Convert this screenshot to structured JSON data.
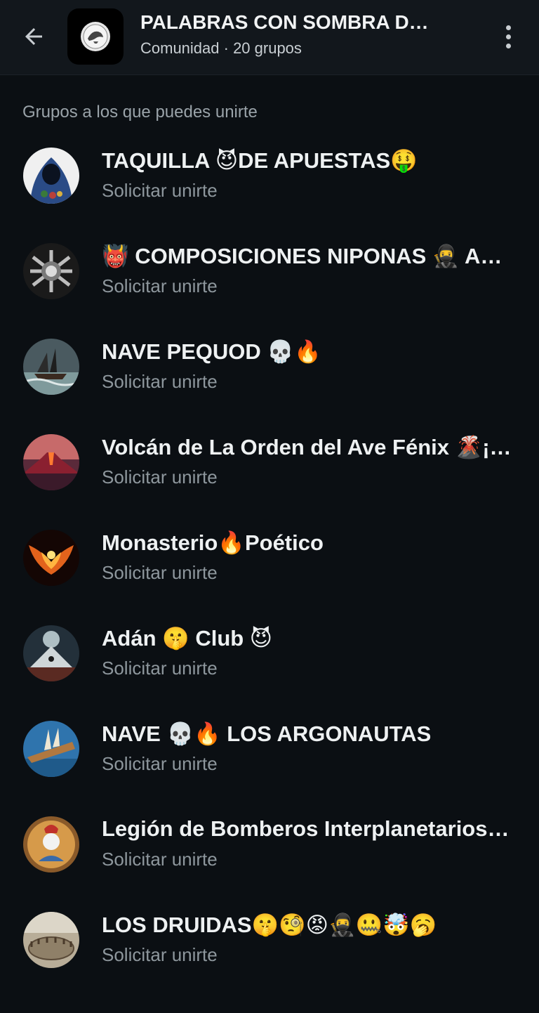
{
  "header": {
    "title": "PALABRAS CON SOMBRA D…",
    "subtitle": "Comunidad · 20 grupos",
    "back_icon": "arrow-left-icon",
    "menu_icon": "more-vertical-icon"
  },
  "section": {
    "title": "Grupos a los que puedes unirte"
  },
  "groups": [
    {
      "name": "TAQUILLA 😈DE APUESTAS🤑",
      "action": "Solicitar unirte",
      "avatar_color": "#2d4a7a"
    },
    {
      "name": "👹 COMPOSICIONES NIPONAS 🥷 A…",
      "action": "Solicitar unirte",
      "avatar_color": "#8a8a8a"
    },
    {
      "name": "NAVE PEQUOD 💀🔥",
      "action": "Solicitar unirte",
      "avatar_color": "#5d6b70"
    },
    {
      "name": "Volcán de La Orden del Ave Fénix 🌋¡…",
      "action": "Solicitar unirte",
      "avatar_color": "#b0463a"
    },
    {
      "name": "Monasterio🔥Poético",
      "action": "Solicitar unirte",
      "avatar_color": "#d0541a"
    },
    {
      "name": "Adán 🤫 Club 😈",
      "action": "Solicitar unirte",
      "avatar_color": "#3c4a58"
    },
    {
      "name": "NAVE 💀🔥 LOS ARGONAUTAS",
      "action": "Solicitar unirte",
      "avatar_color": "#2f6fa0"
    },
    {
      "name": "Legión de Bomberos Interplanetarios…",
      "action": "Solicitar unirte",
      "avatar_color": "#c98a3a"
    },
    {
      "name": "LOS DRUIDAS🤫🧐😡🥷🤐🤯🥱",
      "action": "Solicitar unirte",
      "avatar_color": "#9c8f78"
    }
  ]
}
